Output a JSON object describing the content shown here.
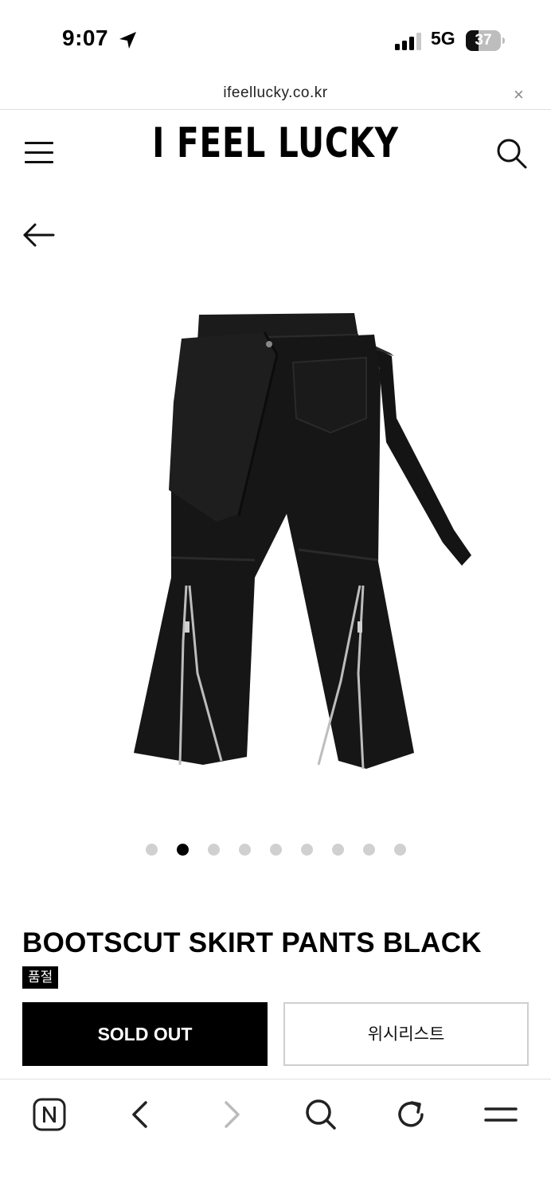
{
  "status_bar": {
    "time": "9:07",
    "network": "5G",
    "battery": "37",
    "battery_level": 0.37,
    "icons": [
      "location-arrow-icon",
      "signal-bars-icon",
      "battery-icon"
    ]
  },
  "browser": {
    "url": "ifeellucky.co.kr",
    "close_label": "×"
  },
  "header": {
    "logo": "I FEEL LUCKY",
    "icons": [
      "hamburger-menu-icon",
      "search-icon",
      "back-arrow-icon"
    ]
  },
  "gallery": {
    "image_alt": "black bootscut skirt pants with zipper flares",
    "slide_count": 9,
    "active_slide": 2
  },
  "product": {
    "title": "BOOTSCUT SKIRT PANTS BLACK",
    "badge": "품절",
    "soldout_label": "SOLD OUT",
    "wishlist_label": "위시리스트"
  },
  "toolbar": {
    "icons": [
      "naver-home-icon",
      "back-icon",
      "forward-icon",
      "search-icon",
      "reload-icon",
      "menu-icon"
    ]
  },
  "colors": {
    "primary": "#000000",
    "muted": "#d0d0d0",
    "border": "#cfcfcf"
  }
}
